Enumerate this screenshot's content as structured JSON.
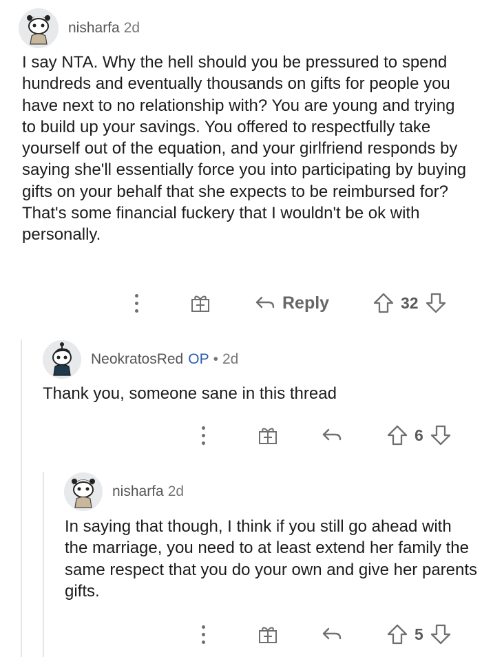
{
  "comments": [
    {
      "username": "nisharfa",
      "age": "2d",
      "body": "I say NTA. Why the hell should you be pressured to spend hundreds and eventually thousands on gifts for people you have next to no relationship with? You are young and trying to build up your savings. You offered to respectfully take yourself out of the equation, and your girlfriend responds by saying she'll essentially force you into participating by buying gifts on your behalf that she expects to be reimbursed for? That's some financial fuckery that I wouldn't be ok with personally.",
      "reply_label": "Reply",
      "votes": "32"
    },
    {
      "username": "NeokratosRed",
      "op_badge": "OP",
      "separator": "•",
      "age": "2d",
      "body": "Thank you, someone sane in this thread",
      "votes": "6"
    },
    {
      "username": "nisharfa",
      "age": "2d",
      "body": "In saying that though, I think if you still go ahead with the marriage, you need to at least extend her family the same respect that you do your own and give her parents gifts.",
      "votes": "5"
    }
  ],
  "icons": {
    "more": "more-options-icon",
    "award": "award-gift-icon",
    "reply": "reply-arrow-icon",
    "upvote": "upvote-arrow-icon",
    "downvote": "downvote-arrow-icon"
  }
}
